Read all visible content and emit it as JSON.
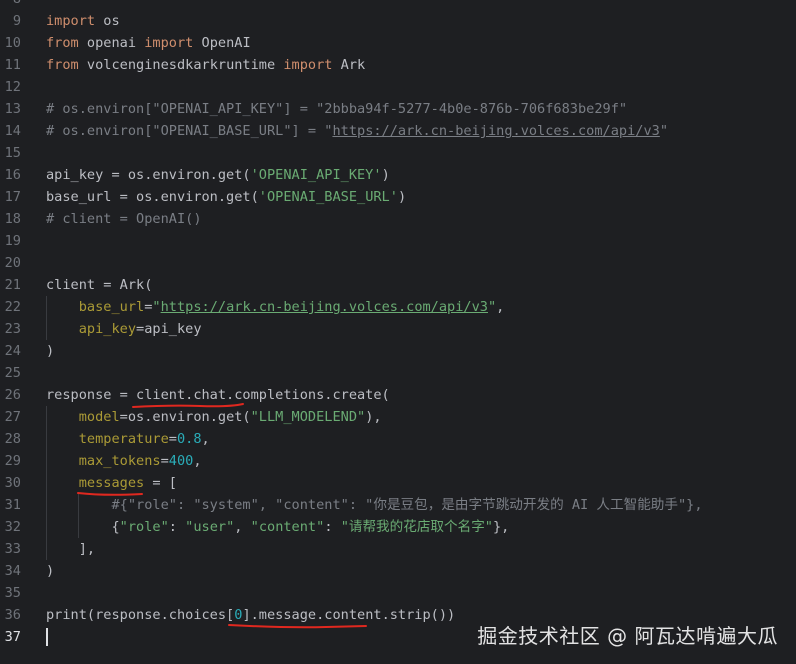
{
  "editor": {
    "lines": [
      {
        "n": "8",
        "tokens": []
      },
      {
        "n": "9",
        "tokens": [
          {
            "t": "import",
            "c": "kw"
          },
          {
            "t": " os"
          }
        ]
      },
      {
        "n": "10",
        "tokens": [
          {
            "t": "from",
            "c": "kw"
          },
          {
            "t": " openai "
          },
          {
            "t": "import",
            "c": "kw"
          },
          {
            "t": " OpenAI"
          }
        ]
      },
      {
        "n": "11",
        "tokens": [
          {
            "t": "from",
            "c": "kw"
          },
          {
            "t": " volcenginesdkarkruntime "
          },
          {
            "t": "import",
            "c": "kw"
          },
          {
            "t": " Ark"
          }
        ]
      },
      {
        "n": "12",
        "tokens": []
      },
      {
        "n": "13",
        "tokens": [
          {
            "t": "# os.environ[\"OPENAI_API_KEY\"] = \"2bbba94f-5277-4b0e-876b-706f683be29f\"",
            "c": "cm"
          }
        ]
      },
      {
        "n": "14",
        "tokens": [
          {
            "t": "# os.environ[\"OPENAI_BASE_URL\"] = \"",
            "c": "cm"
          },
          {
            "t": "https://ark.cn-beijing.volces.com/api/v3",
            "c": "cm link"
          },
          {
            "t": "\"",
            "c": "cm"
          }
        ]
      },
      {
        "n": "15",
        "tokens": []
      },
      {
        "n": "16",
        "tokens": [
          {
            "t": "api_key = os.environ.get("
          },
          {
            "t": "'OPENAI_API_KEY'",
            "c": "str"
          },
          {
            "t": ")"
          }
        ]
      },
      {
        "n": "17",
        "tokens": [
          {
            "t": "base_url = os.environ.get("
          },
          {
            "t": "'OPENAI_BASE_URL'",
            "c": "str"
          },
          {
            "t": ")"
          }
        ]
      },
      {
        "n": "18",
        "tokens": [
          {
            "t": "# client = OpenAI()",
            "c": "cm"
          }
        ]
      },
      {
        "n": "19",
        "tokens": []
      },
      {
        "n": "20",
        "tokens": []
      },
      {
        "n": "21",
        "tokens": [
          {
            "t": "client = Ark("
          }
        ]
      },
      {
        "n": "22",
        "tokens": [
          {
            "t": "    "
          },
          {
            "t": "base_url",
            "c": "kwarg"
          },
          {
            "t": "="
          },
          {
            "t": "\"",
            "c": "str"
          },
          {
            "t": "https://ark.cn-beijing.volces.com/api/v3",
            "c": "str link"
          },
          {
            "t": "\"",
            "c": "str"
          },
          {
            "t": ","
          }
        ]
      },
      {
        "n": "23",
        "tokens": [
          {
            "t": "    "
          },
          {
            "t": "api_key",
            "c": "kwarg"
          },
          {
            "t": "=api_key"
          }
        ]
      },
      {
        "n": "24",
        "tokens": [
          {
            "t": ")"
          }
        ]
      },
      {
        "n": "25",
        "tokens": []
      },
      {
        "n": "26",
        "tokens": [
          {
            "t": "response = client.chat.completions.create("
          }
        ]
      },
      {
        "n": "27",
        "tokens": [
          {
            "t": "    "
          },
          {
            "t": "model",
            "c": "kwarg"
          },
          {
            "t": "=os.environ.get("
          },
          {
            "t": "\"LLM_MODELEND\"",
            "c": "str"
          },
          {
            "t": "),"
          }
        ]
      },
      {
        "n": "28",
        "tokens": [
          {
            "t": "    "
          },
          {
            "t": "temperature",
            "c": "kwarg"
          },
          {
            "t": "="
          },
          {
            "t": "0.8",
            "c": "num"
          },
          {
            "t": ","
          }
        ]
      },
      {
        "n": "29",
        "tokens": [
          {
            "t": "    "
          },
          {
            "t": "max_tokens",
            "c": "kwarg"
          },
          {
            "t": "="
          },
          {
            "t": "400",
            "c": "num"
          },
          {
            "t": ","
          }
        ]
      },
      {
        "n": "30",
        "tokens": [
          {
            "t": "    "
          },
          {
            "t": "messages",
            "c": "kwarg"
          },
          {
            "t": " = ["
          }
        ]
      },
      {
        "n": "31",
        "tokens": [
          {
            "t": "        #{\"role\": \"system\", \"content\": \"你是豆包，是由字节跳动开发的 AI 人工智能助手\"},",
            "c": "cm"
          }
        ]
      },
      {
        "n": "32",
        "tokens": [
          {
            "t": "        {"
          },
          {
            "t": "\"role\"",
            "c": "str"
          },
          {
            "t": ": "
          },
          {
            "t": "\"user\"",
            "c": "str"
          },
          {
            "t": ", "
          },
          {
            "t": "\"content\"",
            "c": "str"
          },
          {
            "t": ": "
          },
          {
            "t": "\"请帮我的花店取个名字\"",
            "c": "str"
          },
          {
            "t": "},"
          }
        ]
      },
      {
        "n": "33",
        "tokens": [
          {
            "t": "    ],"
          }
        ]
      },
      {
        "n": "34",
        "tokens": [
          {
            "t": ")"
          }
        ]
      },
      {
        "n": "35",
        "tokens": []
      },
      {
        "n": "36",
        "tokens": [
          {
            "t": "print",
            "c": "fn"
          },
          {
            "t": "(response.choices["
          },
          {
            "t": "0",
            "c": "num"
          },
          {
            "t": "].message.content.strip())"
          }
        ]
      },
      {
        "n": "37",
        "tokens": []
      }
    ],
    "active_line": "37"
  },
  "colors": {
    "background": "#1e1f22",
    "annotation": "#e0281f"
  },
  "watermark": "掘金技术社区 @ 阿瓦达啃遍大瓜"
}
